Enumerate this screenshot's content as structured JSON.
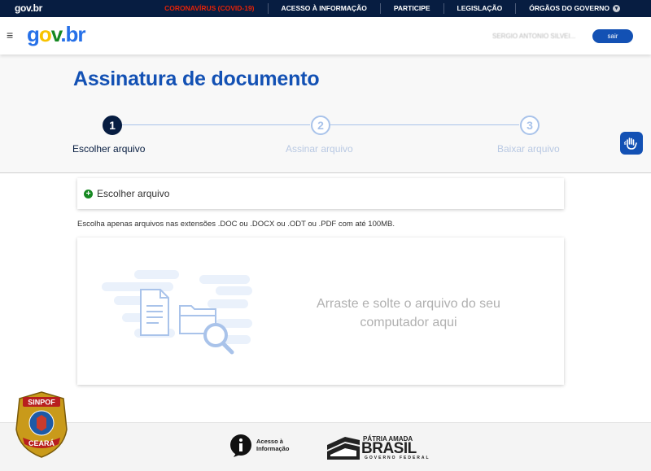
{
  "topbar": {
    "brand": "gov.br",
    "links": [
      "CORONAVÍRUS (COVID-19)",
      "ACESSO À INFORMAÇÃO",
      "PARTICIPE",
      "LEGISLAÇÃO",
      "ÓRGÃOS DO GOVERNO"
    ]
  },
  "header": {
    "logo": {
      "g": "g",
      "o": "o",
      "v": "v",
      "dot": ".",
      "br": "br"
    },
    "user_name": "SERGIO ANTONIO SILVEI...",
    "logout_label": "sair"
  },
  "page": {
    "title": "Assinatura de documento",
    "steps": [
      {
        "number": "1",
        "label": "Escolher arquivo"
      },
      {
        "number": "2",
        "label": "Assinar arquivo"
      },
      {
        "number": "3",
        "label": "Baixar arquivo"
      }
    ]
  },
  "choose_card": {
    "icon": "plus",
    "label": "Escolher arquivo"
  },
  "hint": "Escolha apenas arquivos nas extensões .DOC ou .DOCX ou .ODT ou .PDF com até 100MB.",
  "dropzone": {
    "text": "Arraste e solte o arquivo do seu computador aqui"
  },
  "footer": {
    "info_label_1": "Acesso à",
    "info_label_2": "Informação",
    "patria_1": "PÁTRIA AMADA",
    "patria_2": "BRASIL",
    "patria_3": "GOVERNO FEDERAL"
  },
  "badge": {
    "top": "SINPOF",
    "bottom": "CEARÁ"
  },
  "colors": {
    "primary": "#1351b4",
    "dark": "#071d41",
    "step_inactive": "#a9c3ea",
    "success": "#168821",
    "covid": "#e52207"
  }
}
